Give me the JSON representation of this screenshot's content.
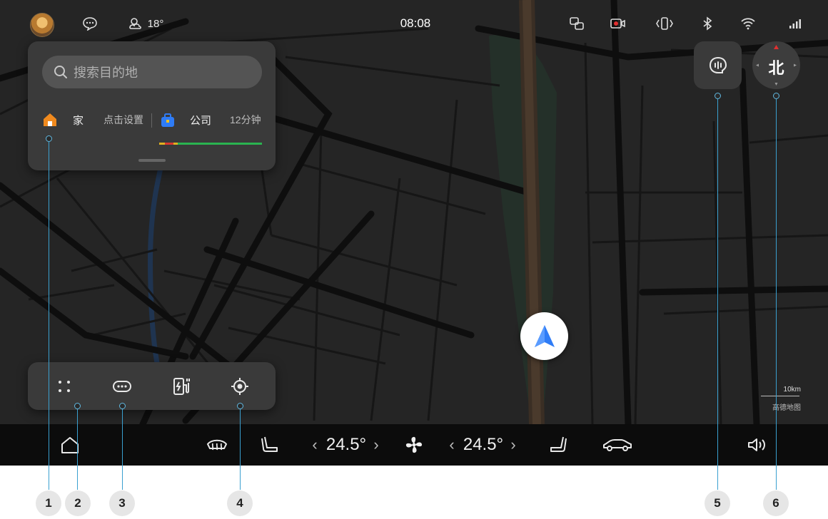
{
  "status_bar": {
    "weather": "18°",
    "time": "08:08",
    "icons": [
      "avatar",
      "message-icon",
      "weather-icon",
      "screen-mirror-icon",
      "record-icon",
      "vibrate-icon",
      "bluetooth-icon",
      "wifi-icon",
      "signal-icon"
    ]
  },
  "nav_panel": {
    "search_placeholder": "搜索目的地",
    "home_label": "家",
    "home_action": "点击设置",
    "work_label": "公司",
    "work_eta": "12分钟"
  },
  "map": {
    "scale_label": "10km",
    "provider": "高德地图",
    "compass_label": "北"
  },
  "toolbar": {
    "icons": [
      "apps-icon",
      "more-icon",
      "charging-station-icon",
      "locate-icon"
    ]
  },
  "dock": {
    "left_temp": "24.5°",
    "right_temp": "24.5°",
    "icons": [
      "home-icon",
      "defrost-icon",
      "driver-seat-icon",
      "fan-icon",
      "passenger-seat-icon",
      "car-icon",
      "volume-icon"
    ]
  },
  "callouts": [
    "1",
    "2",
    "3",
    "4",
    "5",
    "6"
  ],
  "colors": {
    "accent_blue": "#2f7cf6",
    "route_green": "#2ab350",
    "callout_line": "#3aa0d0"
  }
}
